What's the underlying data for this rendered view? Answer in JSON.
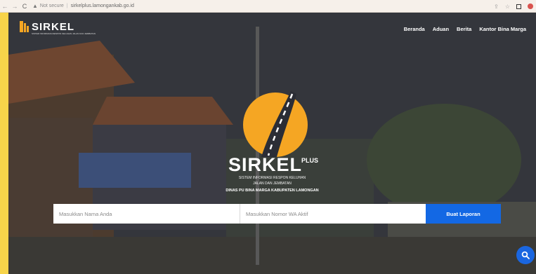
{
  "browser": {
    "security_label": "Not secure",
    "url": "sirkelplus.lamongankab.go.id"
  },
  "site": {
    "logo_text": "SIRKEL",
    "logo_subtitle": "SISTEM INFORMASI RESPON KELUHAN JALAN DAN JEMBATAN",
    "nav": [
      "Beranda",
      "Aduan",
      "Berita",
      "Kantor Bina Marga"
    ]
  },
  "hero": {
    "brand_title": "SIRKEL",
    "brand_plus": "PLUS",
    "tagline_line1": "SISTEM INFORMASI RESPON KELUHAN",
    "tagline_line2": "JALAN DAN JEMBATAN",
    "dinas": "DINAS PU BINA MARGA KABUPATEN LAMONGAN"
  },
  "form": {
    "name_placeholder": "Masukkan Nama Anda",
    "wa_placeholder": "Masukkan Nomor WA Aktif",
    "submit_label": "Buat Laporan"
  },
  "colors": {
    "accent": "#f7d44a",
    "button": "#1368e4",
    "logo_orange": "#f5a623"
  },
  "icons": [
    "back-icon",
    "forward-icon",
    "reload-icon",
    "warning-icon",
    "share-icon",
    "star-icon",
    "extension-icon",
    "profile-icon",
    "search-icon"
  ]
}
